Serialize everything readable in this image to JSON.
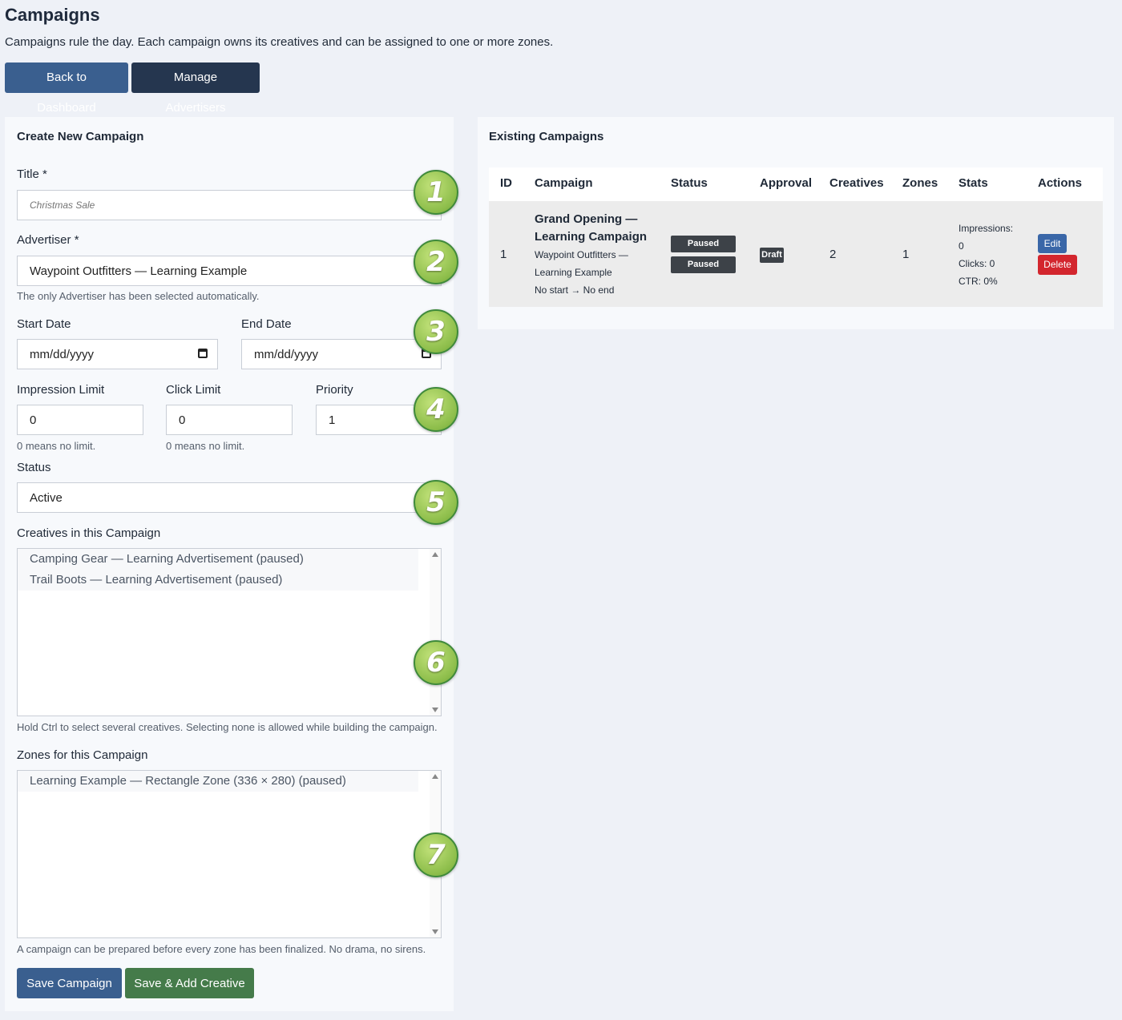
{
  "page": {
    "title": "Campaigns",
    "subtitle": "Campaigns rule the day. Each campaign owns its creatives and can be assigned to one or more zones."
  },
  "nav": {
    "back_label": "Back to Dashboard",
    "advertisers_label": "Manage Advertisers"
  },
  "form": {
    "heading": "Create New Campaign",
    "title_label": "Title *",
    "title_placeholder": "Christmas Sale",
    "advertiser_label": "Advertiser *",
    "advertiser_value": "Waypoint Outfitters — Learning Example",
    "advertiser_hint": "The only Advertiser has been selected automatically.",
    "start_label": "Start Date",
    "start_value": "mm/dd/yyyy",
    "end_label": "End Date",
    "end_value": "mm/dd/yyyy",
    "impression_label": "Impression Limit",
    "impression_value": "0",
    "impression_hint": "0 means no limit.",
    "click_label": "Click Limit",
    "click_value": "0",
    "click_hint": "0 means no limit.",
    "priority_label": "Priority",
    "priority_value": "1",
    "status_label": "Status",
    "status_value": "Active",
    "creatives_label": "Creatives in this Campaign",
    "creatives_options": [
      "Camping Gear — Learning Advertisement (paused)",
      "Trail Boots — Learning Advertisement (paused)"
    ],
    "creatives_hint": "Hold Ctrl to select several creatives. Selecting none is allowed while building the campaign.",
    "zones_label": "Zones for this Campaign",
    "zones_options": [
      "Learning Example — Rectangle Zone (336 × 280) (paused)"
    ],
    "zones_hint": "A campaign can be prepared before every zone has been finalized. No drama, no sirens.",
    "save_label": "Save Campaign",
    "save_add_label": "Save & Add Creative"
  },
  "badges": [
    "1",
    "2",
    "3",
    "4",
    "5",
    "6",
    "7"
  ],
  "table": {
    "heading": "Existing Campaigns",
    "columns": [
      "ID",
      "Campaign",
      "Status",
      "Approval",
      "Creatives",
      "Zones",
      "Stats",
      "Actions"
    ],
    "rows": [
      {
        "id": "1",
        "name_line1": "Grand Opening —",
        "name_line2": "Learning Campaign",
        "adv_line1": "Waypoint Outfitters —",
        "adv_line2": "Learning Example",
        "dates": "No start → No end",
        "status1": "Paused",
        "status2": "Paused",
        "approval": "Draft",
        "creatives": "2",
        "zones": "1",
        "impressions_label": "Impressions:",
        "impressions_value": "0",
        "clicks": "Clicks: 0",
        "ctr": "CTR: 0%",
        "edit_label": "Edit",
        "delete_label": "Delete"
      }
    ]
  },
  "colors": {
    "primary": "#3a5f8f",
    "navy": "#25364f",
    "success": "#457b4a",
    "danger": "#d3262e",
    "edit": "#3a67a8",
    "badge": "#8cbd4a"
  }
}
